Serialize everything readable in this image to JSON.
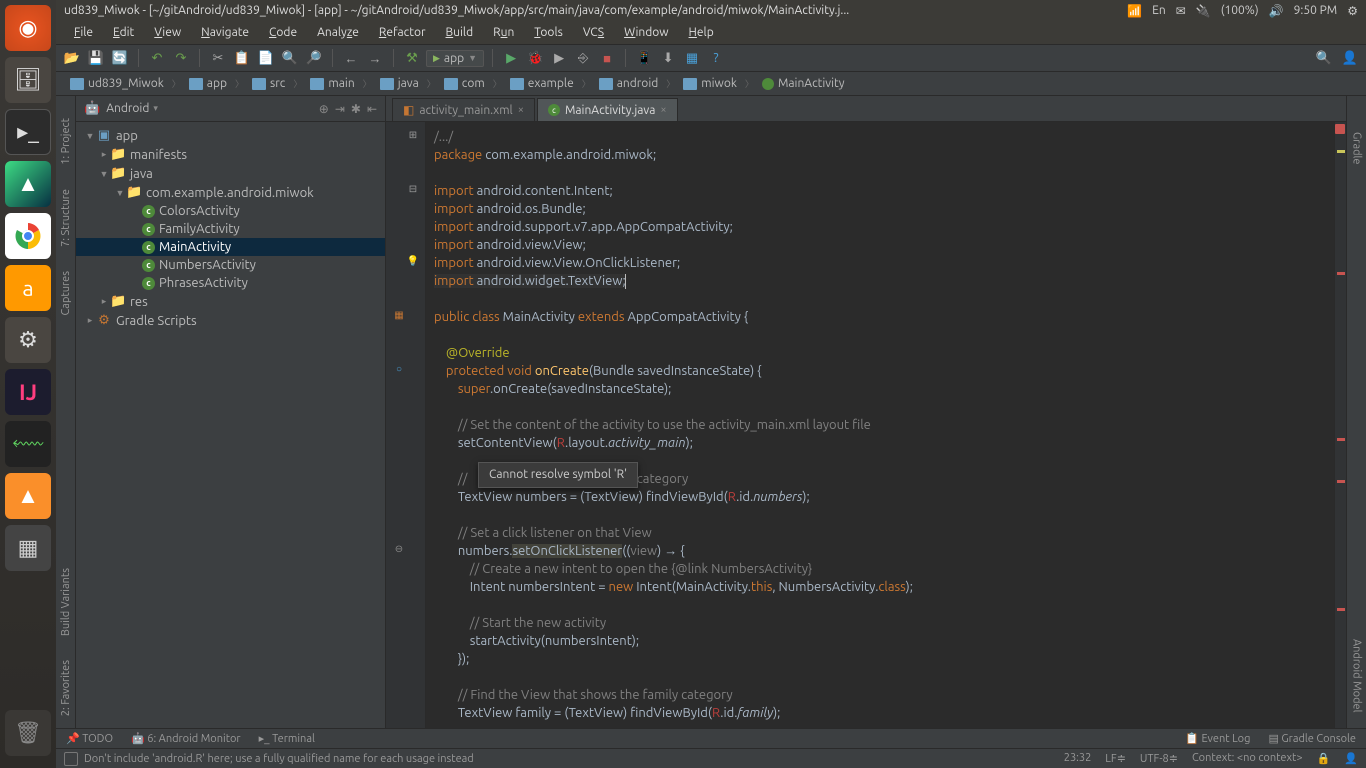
{
  "titlebar": {
    "title": "ud839_Miwok - [~/gitAndroid/ud839_Miwok] - [app] - ~/gitAndroid/ud839_Miwok/app/src/main/java/com/example/android/miwok/MainActivity.j...",
    "lang": "En",
    "battery": "(100%)",
    "time": "9:50 PM"
  },
  "menu": [
    "File",
    "Edit",
    "View",
    "Navigate",
    "Code",
    "Analyze",
    "Refactor",
    "Build",
    "Run",
    "Tools",
    "VCS",
    "Window",
    "Help"
  ],
  "run_config": "app",
  "breadcrumb": [
    "ud839_Miwok",
    "app",
    "src",
    "main",
    "java",
    "com",
    "example",
    "android",
    "miwok",
    "MainActivity"
  ],
  "project_header": "Android",
  "tree": {
    "app": "app",
    "manifests": "manifests",
    "java": "java",
    "pkg": "com.example.android.miwok",
    "c1": "ColorsActivity",
    "c2": "FamilyActivity",
    "c3": "MainActivity",
    "c4": "NumbersActivity",
    "c5": "PhrasesActivity",
    "res": "res",
    "gradle": "Gradle Scripts"
  },
  "tabs": {
    "t1": "activity_main.xml",
    "t2": "MainActivity.java"
  },
  "tooltip": "Cannot resolve symbol 'R'",
  "left_labels": {
    "project": "1: Project",
    "structure": "7: Structure",
    "captures": "Captures",
    "bv": "Build Variants",
    "fav": "2: Favorites"
  },
  "right_labels": {
    "gradle": "Gradle",
    "am": "Android Model"
  },
  "bottom": {
    "todo": "TODO",
    "monitor": "6: Android Monitor",
    "terminal": "Terminal",
    "eventlog": "Event Log",
    "gradlec": "Gradle Console"
  },
  "status": {
    "msg": "Don't include 'android.R' here; use a fully qualified name for each usage instead",
    "pos": "23:32",
    "lf": "LF",
    "enc": "UTF-8",
    "ctx": "Context: <no context>"
  },
  "code": {
    "fold": "/.../",
    "pkg": "com.example.android.miwok",
    "imp1": "android.content.Intent",
    "imp2": "android.os.Bundle",
    "imp3": "android.support.v7.app.AppCompatActivity",
    "imp4": "android.view.View",
    "imp5": "android.view.View.OnClickListener",
    "imp6": "android.widget.TextView",
    "className": "MainActivity",
    "extends": "AppCompatActivity",
    "override": "@Override",
    "onCreate": "onCreate",
    "bundle": "Bundle",
    "param": "savedInstanceState",
    "super": "super",
    "setcv": "setContentView",
    "layout": "layout",
    "actmain": "activity_main",
    "com1": "// Set the content of the activity to use the activity_main.xml layout file",
    "com2a": "// ",
    "com2b": " the numbers category",
    "tv": "TextView",
    "numbers": "numbers",
    "fvbi": "findViewById",
    "id": "id",
    "com3": "// Set a click listener on that View",
    "socl": "setOnClickListener",
    "view": "view",
    "com4": "// Create a new intent to open the {@link NumbersActivity}",
    "intent": "Intent",
    "ni": "numbersIntent",
    "new": "new",
    "this": "this",
    "nact": "NumbersActivity",
    "classkw": "class",
    "com5": "// Start the new activity",
    "sa": "startActivity",
    "com6": "// Find the View that shows the family category",
    "family": "family"
  }
}
